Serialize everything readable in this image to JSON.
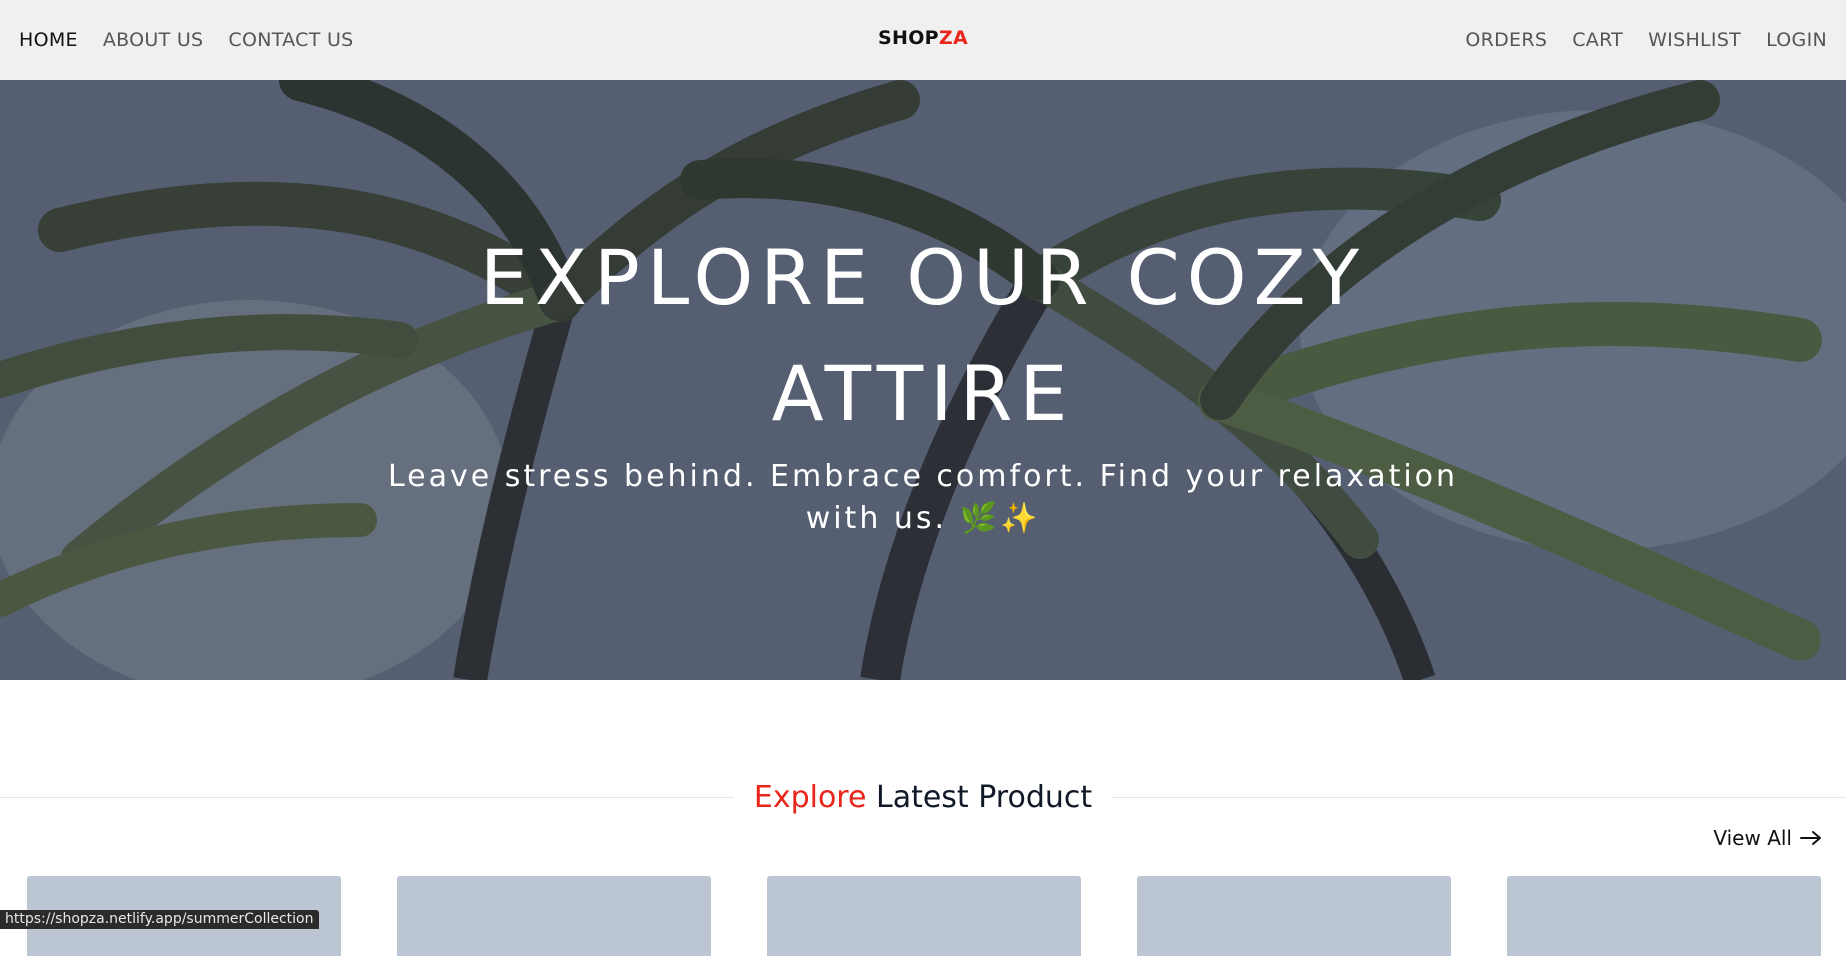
{
  "nav": {
    "left": [
      {
        "label": "HOME",
        "active": true
      },
      {
        "label": "ABOUT US",
        "active": false
      },
      {
        "label": "CONTACT US",
        "active": false
      }
    ],
    "brand_part1": "SHOP",
    "brand_part2": "ZA",
    "right": [
      {
        "label": "ORDERS"
      },
      {
        "label": "CART"
      },
      {
        "label": "WISHLIST"
      },
      {
        "label": "LOGIN"
      }
    ]
  },
  "hero": {
    "title": "EXPLORE OUR COZY ATTIRE",
    "subtitle": "Leave stress behind. Embrace comfort. Find your relaxation with us. 🌿✨"
  },
  "section": {
    "title_accent": "Explore",
    "title_rest": " Latest Product",
    "view_all": "View All",
    "view_all_icon": "arrow-right-icon"
  },
  "status_url": "https://shopza.netlify.app/summerCollection",
  "colors": {
    "accent": "#e8261c",
    "navbar_bg": "#f0f0f0",
    "card_placeholder": "#bcc6d3"
  }
}
